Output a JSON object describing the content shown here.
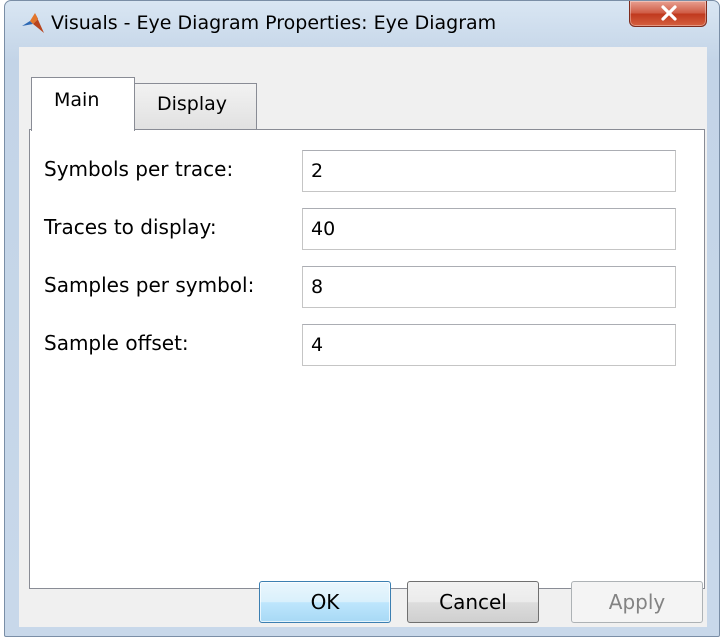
{
  "window": {
    "title": "Visuals - Eye Diagram Properties: Eye Diagram",
    "app_icon": "matlab-logo-icon",
    "close_icon": "close-icon"
  },
  "tabs": [
    {
      "label": "Main",
      "selected": true
    },
    {
      "label": "Display",
      "selected": false
    }
  ],
  "fields": [
    {
      "label": "Symbols per trace:",
      "value": "2"
    },
    {
      "label": "Traces to display:",
      "value": "40"
    },
    {
      "label": "Samples per symbol:",
      "value": "8"
    },
    {
      "label": "Sample offset:",
      "value": "4"
    }
  ],
  "buttons": {
    "ok": "OK",
    "cancel": "Cancel",
    "apply": "Apply",
    "apply_enabled": false
  },
  "colors": {
    "close_button": "#c7432a",
    "ok_button_border": "#3c7fb1",
    "disabled_text": "#838383"
  }
}
